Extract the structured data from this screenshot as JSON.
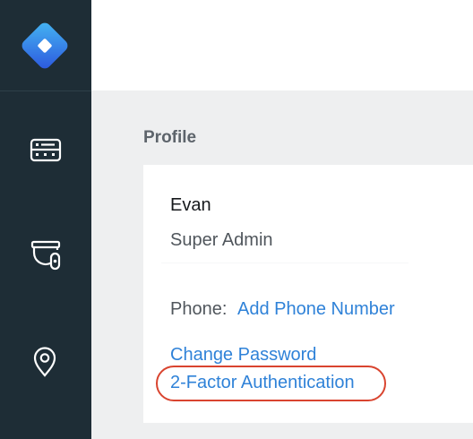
{
  "sidebar": {
    "logo_icon": "diamond-logo-icon",
    "items": [
      {
        "icon": "dashboard-icon"
      },
      {
        "icon": "security-camera-icon"
      },
      {
        "icon": "location-pin-icon"
      }
    ]
  },
  "profile": {
    "section_title": "Profile",
    "name": "Evan",
    "role": "Super Admin",
    "phone_label": "Phone:",
    "phone_link": "Add Phone Number",
    "change_password": "Change Password",
    "two_factor": "2-Factor Authentication"
  },
  "colors": {
    "sidebar_bg": "#1e2d36",
    "link": "#2f82d8",
    "highlight": "#d9442f",
    "logo_gradient": [
      "#3aa7ee",
      "#2f5fe0"
    ]
  }
}
